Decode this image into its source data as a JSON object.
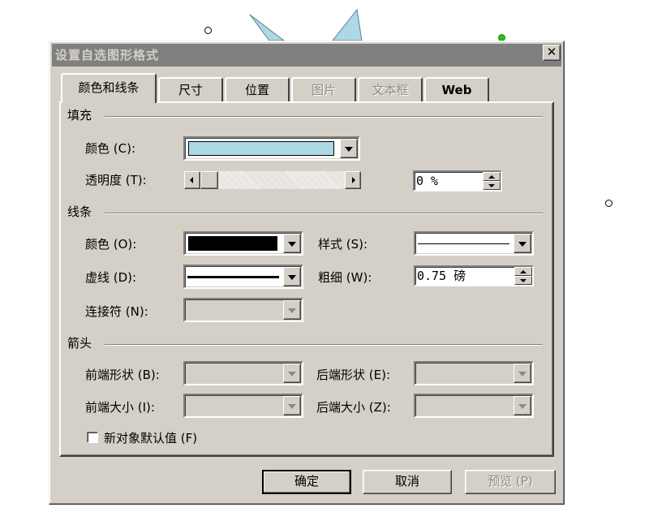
{
  "dialog": {
    "title": "设置自选图形格式",
    "close_symbol": "✕"
  },
  "tabs": [
    {
      "label": "颜色和线条",
      "active": true,
      "enabled": true
    },
    {
      "label": "尺寸",
      "active": false,
      "enabled": true
    },
    {
      "label": "位置",
      "active": false,
      "enabled": true
    },
    {
      "label": "图片",
      "active": false,
      "enabled": false
    },
    {
      "label": "文本框",
      "active": false,
      "enabled": false
    },
    {
      "label": "Web",
      "active": false,
      "enabled": true
    }
  ],
  "fill": {
    "section_title": "填充",
    "color_label": "颜色 (C):",
    "color_value": "#add8e6",
    "transparency_label": "透明度 (T):",
    "transparency_value": "0 %",
    "transparency_fraction": 0
  },
  "line": {
    "section_title": "线条",
    "color_label": "颜色 (O):",
    "color_value": "#000000",
    "style_label": "样式 (S):",
    "dash_label": "虚线 (D):",
    "weight_label": "粗细 (W):",
    "weight_value": "0.75 磅",
    "connector_label": "连接符 (N):"
  },
  "arrows": {
    "section_title": "箭头",
    "begin_style_label": "前端形状 (B):",
    "end_style_label": "后端形状 (E):",
    "begin_size_label": "前端大小 (I):",
    "end_size_label": "后端大小 (Z):"
  },
  "default_checkbox": {
    "label": "新对象默认值 (F)",
    "checked": false
  },
  "buttons": {
    "ok": "确定",
    "cancel": "取消",
    "preview": "预览 (P)"
  },
  "canvas": {
    "shape_fill": "#add8e6",
    "handle_color": "#22c022"
  }
}
